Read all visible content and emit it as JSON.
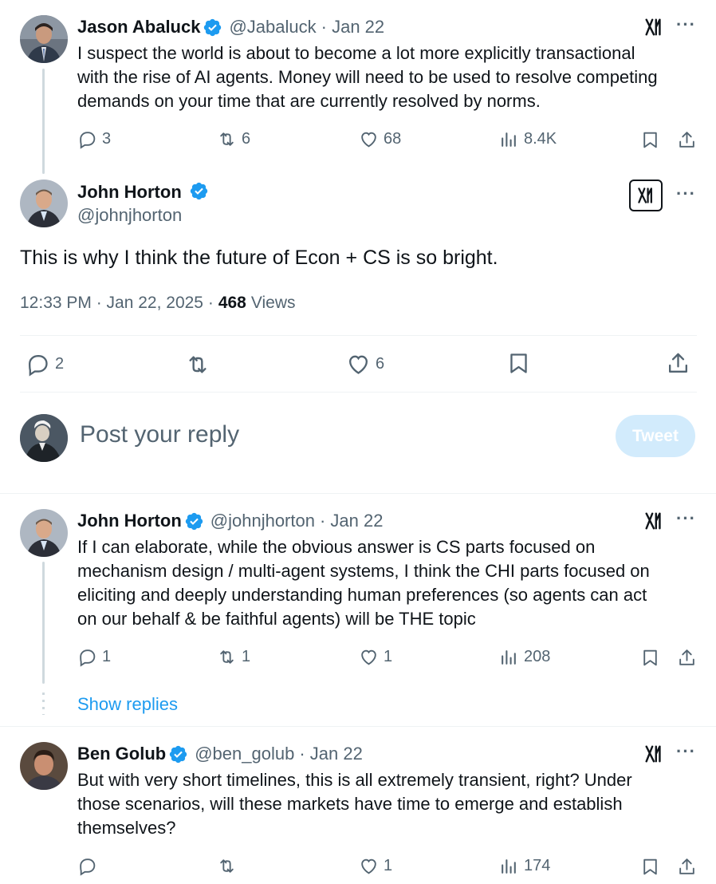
{
  "tweets": {
    "parent": {
      "name": "Jason Abaluck",
      "handle": "@Jabaluck",
      "date": "· Jan 22",
      "lines": [
        "I suspect the world is about to become a lot more explicitly transactional",
        "with the rise of AI agents. Money will need to be used to resolve competing",
        "demands on your time that are currently resolved by norms."
      ],
      "replies": "3",
      "reposts": "6",
      "likes": "68",
      "views": "8.4K"
    },
    "main": {
      "name": "John Horton",
      "handle": "@johnjhorton",
      "text": "This is why I think the future of Econ + CS is so bright.",
      "time": "12:33 PM · Jan 22, 2025 ·",
      "views_count": "468",
      "views_label": "Views",
      "replies": "2",
      "likes": "6"
    },
    "reply1": {
      "name": "John Horton",
      "handle": "@johnjhorton",
      "date": "· Jan 22",
      "lines": [
        "If I can elaborate, while the obvious answer is CS parts focused on",
        "mechanism design / multi-agent systems, I think the CHI parts focused on",
        "eliciting and deeply understanding human preferences (so agents can act",
        "on our behalf & be faithful agents) will be THE topic"
      ],
      "replies": "1",
      "reposts": "1",
      "likes": "1",
      "views": "208",
      "show_replies": "Show replies"
    },
    "reply2": {
      "name": "Ben Golub",
      "handle": "@ben_golub",
      "date": "· Jan 22",
      "lines": [
        "But with very short timelines, this is all extremely transient, right? Under",
        "those scenarios, will these markets have time to emerge and establish",
        "themselves?"
      ],
      "likes": "1",
      "views": "174"
    }
  },
  "composer": {
    "placeholder": "Post your reply",
    "tweet_button": "Tweet"
  },
  "icons": {
    "more": "more-icon",
    "grok": "grok-icon",
    "verified": "verified-badge-icon",
    "reply": "reply-icon",
    "repost": "repost-icon",
    "like": "like-icon",
    "views": "views-icon",
    "bookmark": "bookmark-icon",
    "share": "share-icon"
  },
  "colors": {
    "accent": "#1d9bf0",
    "text": "#0f1419",
    "secondary": "#536471",
    "tweet_button_bg": "#8ecdf8"
  }
}
